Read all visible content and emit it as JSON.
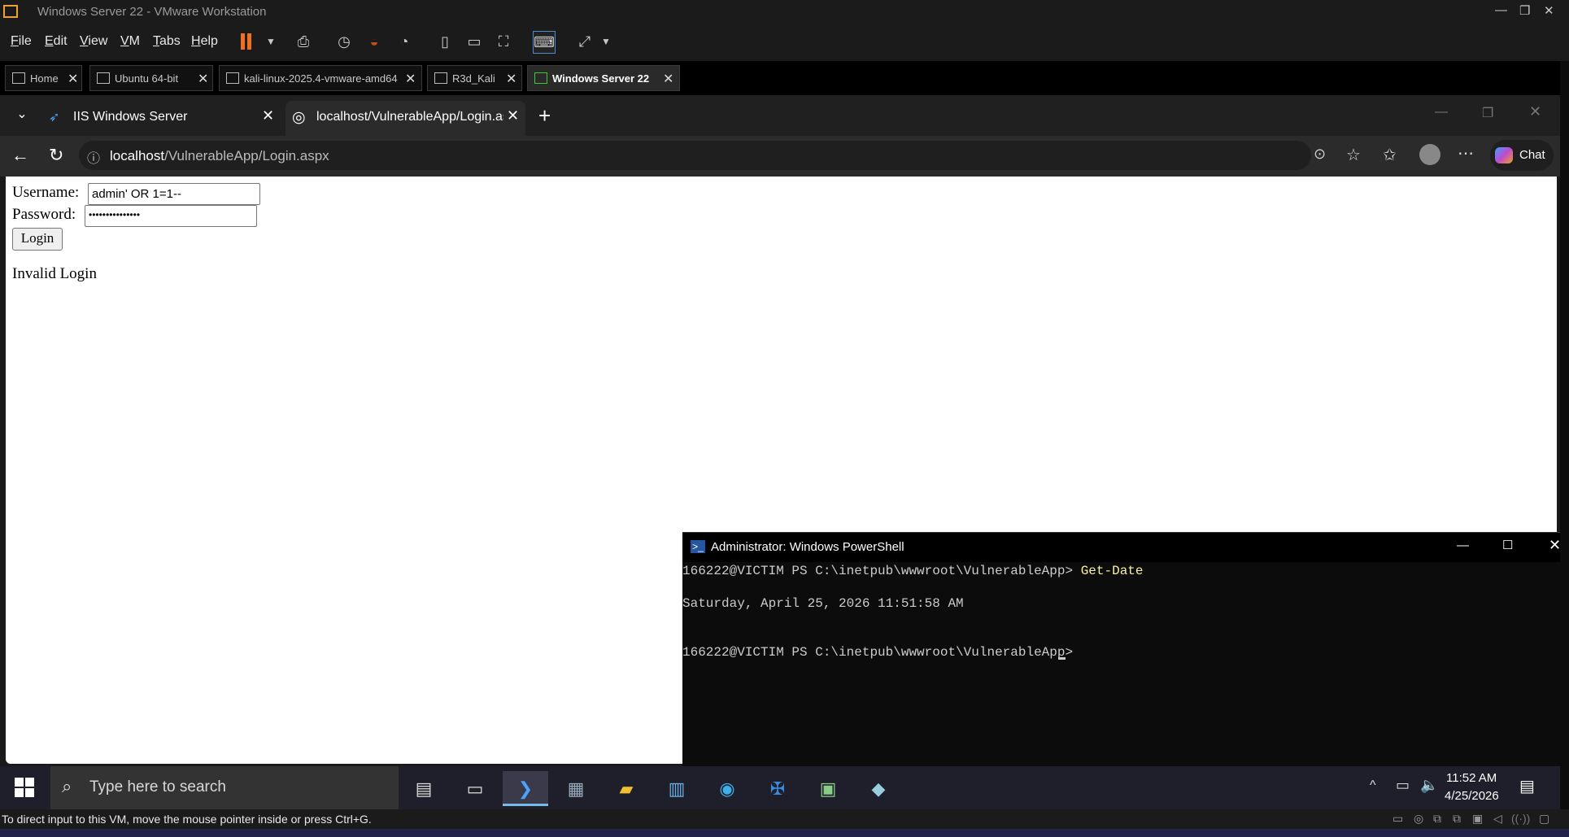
{
  "vmware": {
    "title": "Windows Server 22 - VMware Workstation",
    "menu": [
      {
        "label": "File",
        "u": "F",
        "rest": "ile"
      },
      {
        "label": "Edit",
        "u": "E",
        "rest": "dit"
      },
      {
        "label": "View",
        "u": "V",
        "rest": "iew"
      },
      {
        "label": "VM",
        "u": "V",
        "rest": "M"
      },
      {
        "label": "Tabs",
        "u": "T",
        "rest": "abs"
      },
      {
        "label": "Help",
        "u": "H",
        "rest": "elp"
      }
    ],
    "tabs": [
      "Home",
      "Ubuntu 64-bit",
      "kali-linux-2025.4-vmware-amd64",
      "R3d_Kali",
      "Windows Server 22"
    ],
    "status_text": "To direct input to this VM, move the mouse pointer inside or press Ctrl+G."
  },
  "edge": {
    "tabs": [
      "IIS Windows Server",
      "localhost/VulnerableApp/Login.aspx"
    ],
    "url_host": "localhost",
    "url_path": "/VulnerableApp/Login.aspx",
    "chat_label": "Chat"
  },
  "page": {
    "username_label": "Username:",
    "username_value": "admin' OR 1=1--",
    "password_label": "Password:",
    "password_value": "•••••••••••••••",
    "login_button": "Login",
    "message": "Invalid Login"
  },
  "powershell": {
    "title": "Administrator: Windows PowerShell",
    "prompt": "166222@VICTIM PS C:\\inetpub\\wwwroot\\VulnerableApp> ",
    "command": "Get-Date",
    "output": "Saturday, April 25, 2026 11:51:58 AM",
    "prompt2": "166222@VICTIM PS C:\\inetpub\\wwwroot\\VulnerableApp> "
  },
  "taskbar": {
    "search_placeholder": "Type here to search",
    "time": "11:52 AM",
    "date": "4/25/2026"
  }
}
